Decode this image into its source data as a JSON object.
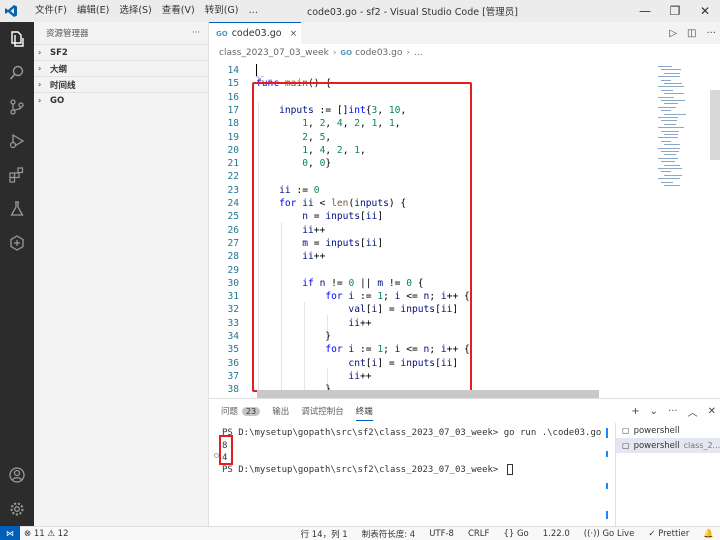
{
  "titlebar": {
    "menu": [
      "文件(F)",
      "编辑(E)",
      "选择(S)",
      "查看(V)",
      "转到(G)",
      "…"
    ],
    "title": "code03.go - sf2 - Visual Studio Code [管理员]",
    "win_min": "—",
    "win_max": "❐",
    "win_close": "✕"
  },
  "sidebar": {
    "header": "资源管理器",
    "more": "···",
    "sections": [
      "SF2",
      "大纲",
      "时间线",
      "GO"
    ]
  },
  "tab": {
    "label": "code03.go",
    "close": "×",
    "icon": "GO"
  },
  "breadcrumb": {
    "folder": "class_2023_07_03_week",
    "file": "code03.go",
    "tail": "..."
  },
  "editor": {
    "lines": [
      {
        "n": "14",
        "t": ""
      },
      {
        "n": "15",
        "t": "func main() {"
      },
      {
        "n": "16",
        "t": ""
      },
      {
        "n": "17",
        "t": "    inputs := []int{3, 10,"
      },
      {
        "n": "18",
        "t": "        1, 2, 4, 2, 1, 1,"
      },
      {
        "n": "19",
        "t": "        2, 5,"
      },
      {
        "n": "20",
        "t": "        1, 4, 2, 1,"
      },
      {
        "n": "21",
        "t": "        0, 0}"
      },
      {
        "n": "22",
        "t": ""
      },
      {
        "n": "23",
        "t": "    ii := 0"
      },
      {
        "n": "24",
        "t": "    for ii < len(inputs) {"
      },
      {
        "n": "25",
        "t": "        n = inputs[ii]"
      },
      {
        "n": "26",
        "t": "        ii++"
      },
      {
        "n": "27",
        "t": "        m = inputs[ii]"
      },
      {
        "n": "28",
        "t": "        ii++"
      },
      {
        "n": "29",
        "t": ""
      },
      {
        "n": "30",
        "t": "        if n != 0 || m != 0 {"
      },
      {
        "n": "31",
        "t": "            for i := 1; i <= n; i++ {"
      },
      {
        "n": "32",
        "t": "                val[i] = inputs[ii]"
      },
      {
        "n": "33",
        "t": "                ii++"
      },
      {
        "n": "34",
        "t": "            }"
      },
      {
        "n": "35",
        "t": "            for i := 1; i <= n; i++ {"
      },
      {
        "n": "36",
        "t": "                cnt[i] = inputs[ii]"
      },
      {
        "n": "37",
        "t": "                ii++"
      },
      {
        "n": "38",
        "t": "            }"
      }
    ]
  },
  "panel": {
    "tabs": [
      "问题",
      "输出",
      "调试控制台",
      "终端"
    ],
    "problems_count": "23",
    "terminal": {
      "prompt1": "PS D:\\mysetup\\gopath\\src\\sf2\\class_2023_07_03_week> go run .\\code03.go",
      "out1": "8",
      "out2": "4",
      "prompt2": "PS D:\\mysetup\\gopath\\src\\sf2\\class_2023_07_03_week> "
    },
    "term_list": [
      {
        "name": "powershell",
        "sub": ""
      },
      {
        "name": "powershell",
        "sub": "class_2..."
      }
    ]
  },
  "status": {
    "errors": "⊗ 11 ⚠ 12",
    "position": "行 14，列 1",
    "tabsize": "制表符长度: 4",
    "encoding": "UTF-8",
    "eol": "CRLF",
    "language": "{} Go",
    "version": "1.22.0",
    "golive": "((·)) Go Live",
    "prettier": "✓ Prettier",
    "bell": "🔔"
  }
}
